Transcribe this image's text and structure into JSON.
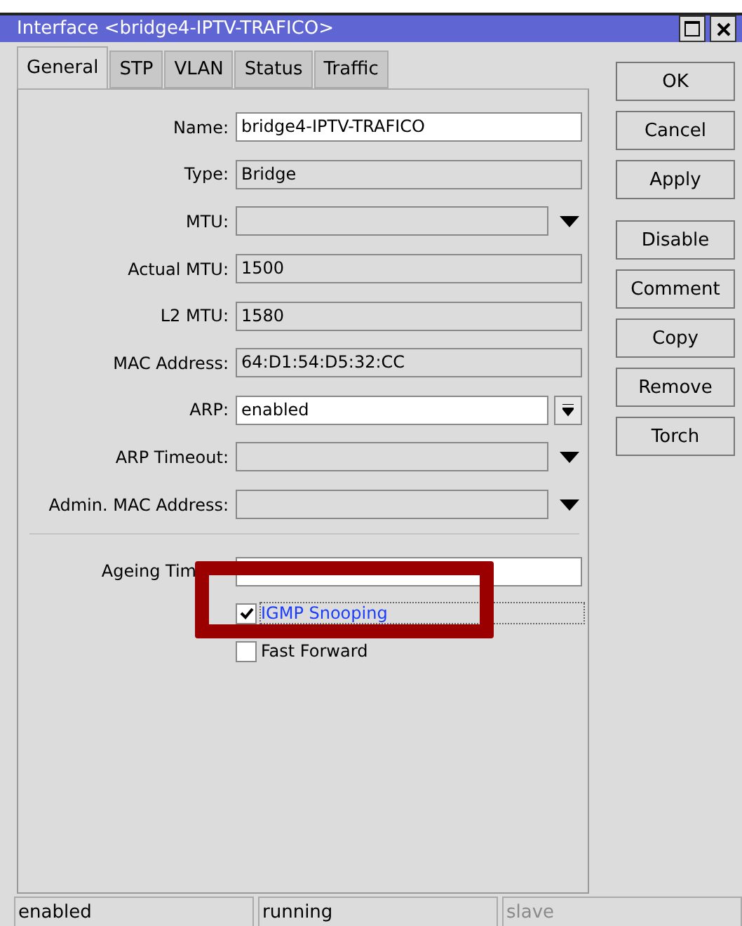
{
  "window": {
    "title": "Interface <bridge4-IPTV-TRAFICO>"
  },
  "tabs": [
    {
      "label": "General",
      "selected": true
    },
    {
      "label": "STP",
      "selected": false
    },
    {
      "label": "VLAN",
      "selected": false
    },
    {
      "label": "Status",
      "selected": false
    },
    {
      "label": "Traffic",
      "selected": false
    }
  ],
  "fields": [
    {
      "label": "Name:",
      "value": "bridge4-IPTV-TRAFICO",
      "kind": "text"
    },
    {
      "label": "Type:",
      "value": "Bridge",
      "kind": "readonly"
    },
    {
      "label": "MTU:",
      "kind": "dropdown"
    },
    {
      "label": "Actual MTU:",
      "value": "1500",
      "kind": "readonly"
    },
    {
      "label": "L2 MTU:",
      "value": "1580",
      "kind": "readonly"
    },
    {
      "label": "MAC Address:",
      "value": "64:D1:54:D5:32:CC",
      "kind": "readonly"
    },
    {
      "label": "ARP:",
      "value": "enabled",
      "kind": "select"
    },
    {
      "label": "ARP Timeout:",
      "kind": "dropdown"
    },
    {
      "label": "Admin. MAC Address:",
      "kind": "dropdown"
    }
  ],
  "ageing": {
    "label": "Ageing Tim"
  },
  "checkboxes": [
    {
      "label": "IGMP Snooping",
      "checked": true,
      "focused": true
    },
    {
      "label": "Fast Forward",
      "checked": false,
      "focused": false
    }
  ],
  "button_groups": [
    [
      "OK",
      "Cancel",
      "Apply"
    ],
    [
      "Disable",
      "Comment",
      "Copy",
      "Remove",
      "Torch"
    ]
  ],
  "status_bar": [
    {
      "text": "enabled",
      "disabled": false
    },
    {
      "text": "running",
      "disabled": false
    },
    {
      "text": "slave",
      "disabled": true
    }
  ]
}
